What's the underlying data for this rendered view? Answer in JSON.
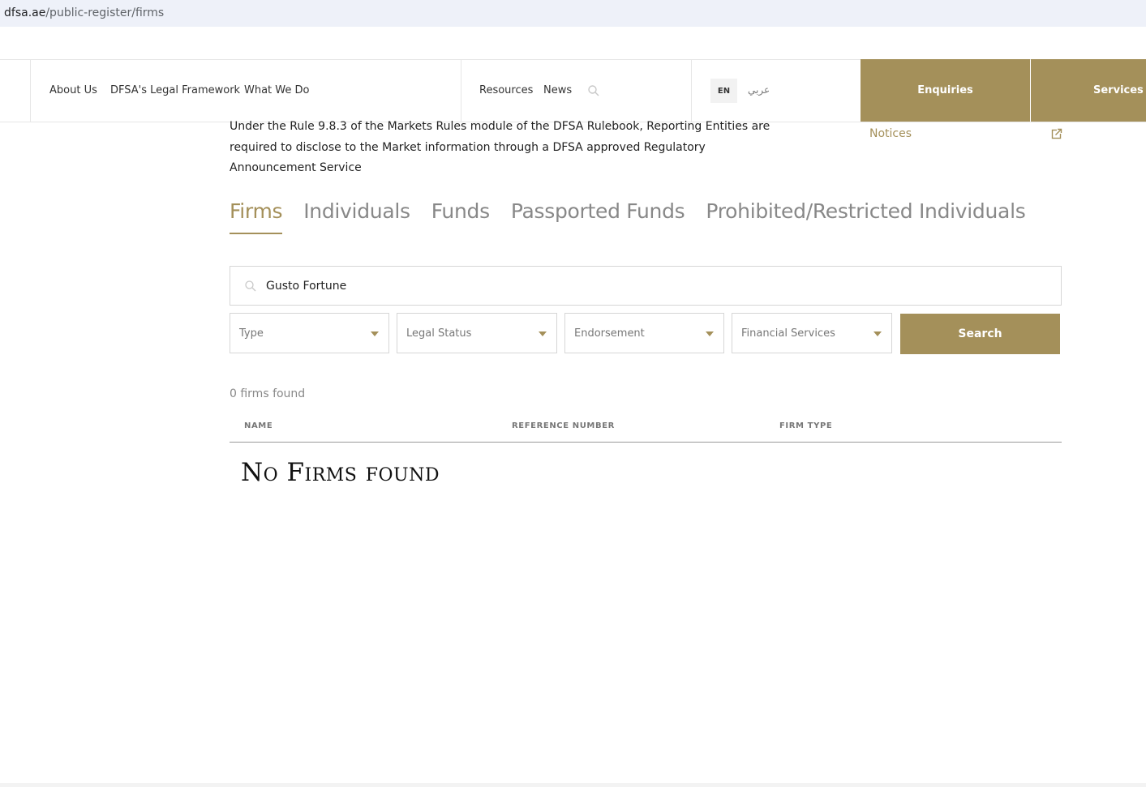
{
  "browser": {
    "url_domain": "dfsa.ae",
    "url_path": "/public-register/firms"
  },
  "nav": {
    "links": [
      "About Us",
      "DFSA's Legal Framework",
      "What We Do",
      "Resources",
      "News"
    ],
    "search_icon": "search-icon",
    "lang_en": "EN",
    "lang_ar": "عربي",
    "enquiries": "Enquiries",
    "services": "Services"
  },
  "intro": {
    "text": "Under the Rule 9.8.3 of the Markets Rules module of the DFSA Rulebook, Reporting Entities are required to disclose to the Market information through a DFSA approved Regulatory Announcement Service"
  },
  "sidebar": {
    "notices": "Notices",
    "notices_icon": "external-link-icon"
  },
  "tabs": [
    {
      "label": "Firms",
      "active": true
    },
    {
      "label": "Individuals",
      "active": false
    },
    {
      "label": "Funds",
      "active": false
    },
    {
      "label": "Passported Funds",
      "active": false
    },
    {
      "label": "Prohibited/Restricted Individuals",
      "active": false
    }
  ],
  "search": {
    "value": "Gusto Fortune",
    "icon": "search-icon"
  },
  "filters": [
    {
      "label": "Type"
    },
    {
      "label": "Legal Status"
    },
    {
      "label": "Endorsement"
    },
    {
      "label": "Financial Services"
    }
  ],
  "search_button": "Search",
  "results": {
    "count_text": "0 firms found",
    "columns": [
      "NAME",
      "REFERENCE NUMBER",
      "FIRM TYPE"
    ],
    "empty_message": "No Firms found"
  },
  "colors": {
    "accent": "#a4905a",
    "url_bar": "#eef1f9"
  }
}
